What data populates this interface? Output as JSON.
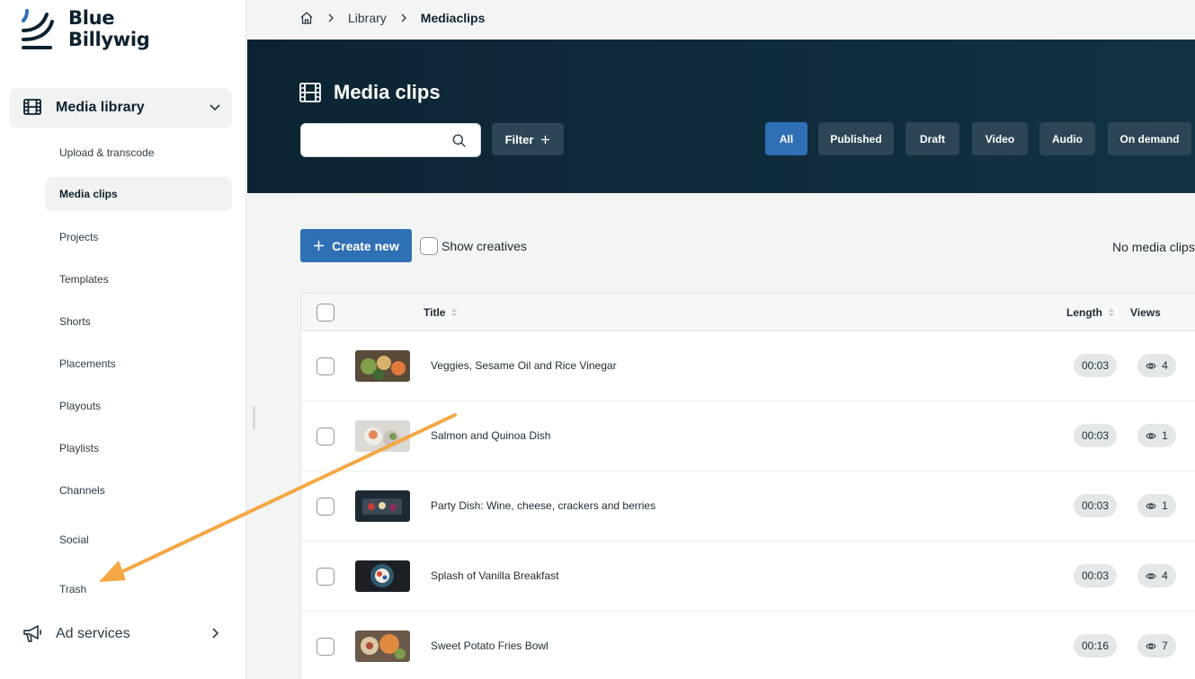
{
  "brand": {
    "line1": "Blue",
    "line2": "Billywig"
  },
  "sidebar": {
    "group": {
      "label": "Media library",
      "icon": "film-icon"
    },
    "items": [
      {
        "label": "Upload & transcode",
        "active": false
      },
      {
        "label": "Media clips",
        "active": true
      },
      {
        "label": "Projects",
        "active": false
      },
      {
        "label": "Templates",
        "active": false
      },
      {
        "label": "Shorts",
        "active": false
      },
      {
        "label": "Placements",
        "active": false
      },
      {
        "label": "Playouts",
        "active": false
      },
      {
        "label": "Playlists",
        "active": false
      },
      {
        "label": "Channels",
        "active": false
      },
      {
        "label": "Social",
        "active": false
      },
      {
        "label": "Trash",
        "active": false
      }
    ],
    "ad_services": {
      "label": "Ad services",
      "icon": "megaphone-icon"
    }
  },
  "breadcrumb": {
    "home_icon": "home-icon",
    "items": [
      "Library",
      "Mediaclips"
    ]
  },
  "header": {
    "title": "Media clips",
    "search": {
      "value": "",
      "placeholder": ""
    },
    "filter_label": "Filter",
    "chips": [
      "All",
      "Published",
      "Draft",
      "Video",
      "Audio",
      "On demand"
    ],
    "active_chip": "All"
  },
  "actions": {
    "create_label": "Create new",
    "show_creatives_label": "Show creatives",
    "status_text": "No media clips s"
  },
  "table": {
    "columns": {
      "title": "Title",
      "length": "Length",
      "views": "Views"
    },
    "rows": [
      {
        "title": "Veggies, Sesame Oil and Rice Vinegar",
        "length": "00:03",
        "views": "4"
      },
      {
        "title": "Salmon and Quinoa Dish",
        "length": "00:03",
        "views": "1"
      },
      {
        "title": "Party Dish: Wine, cheese, crackers and berries",
        "length": "00:03",
        "views": "1"
      },
      {
        "title": "Splash of Vanilla Breakfast",
        "length": "00:03",
        "views": "4"
      },
      {
        "title": "Sweet Potato Fries Bowl",
        "length": "00:16",
        "views": "7"
      }
    ]
  },
  "colors": {
    "primary": "#2f6fb6",
    "hero_bg": "#0c2432",
    "annotation_arrow": "#f4a742"
  }
}
